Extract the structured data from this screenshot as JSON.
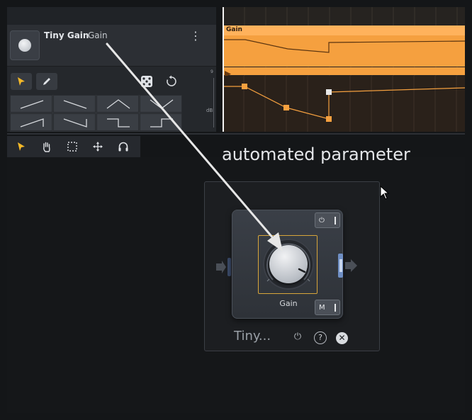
{
  "track": {
    "plugin_name": "Tiny Gain",
    "parameter": "Gain"
  },
  "clip": {
    "label": "Gain"
  },
  "ruler": {
    "top_value": "9",
    "unit": "dB"
  },
  "caption": "automated parameter",
  "plugin_window": {
    "knob_label": "Gain",
    "bypass_label": "⏻",
    "mono_label": "M",
    "name": "Tiny...",
    "help_label": "?",
    "close_label": "✕",
    "power_label": "⏻"
  },
  "icons": {
    "menu": "⋮",
    "pointer": "pointer-icon",
    "pencil": "pencil-icon",
    "dice": "dice-icon",
    "reset": "reset-icon"
  },
  "colors": {
    "clip_orange": "#f5a03f",
    "selection_yellow": "#f5b928",
    "focus_border": "#d8a53a"
  }
}
